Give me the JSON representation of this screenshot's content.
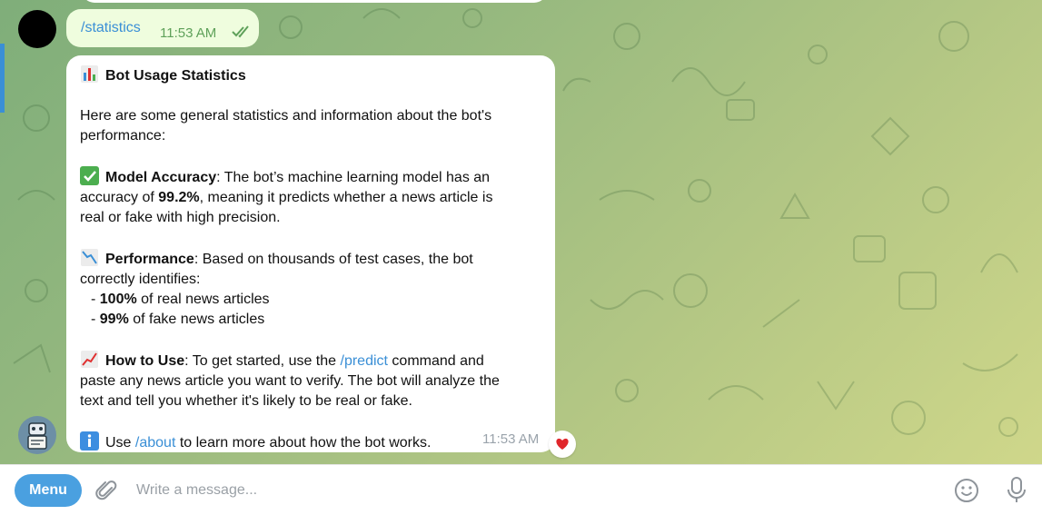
{
  "chat": {
    "command": {
      "text": "/statistics",
      "time": "11:53 AM"
    },
    "bot_message": {
      "title": "Bot Usage Statistics",
      "intro_1": "Here are some general statistics and information about the bot's",
      "intro_2": "performance:",
      "accuracy": {
        "label": "Model Accuracy",
        "text_1": ": The bot’s machine learning model has an",
        "text_2a": "accuracy of ",
        "value": "99.2%",
        "text_2b": ", meaning it predicts whether a news article is",
        "text_3": "real or fake with high precision."
      },
      "performance": {
        "label": "Performance",
        "text_1": ": Based on thousands of test cases, the bot",
        "text_2": "correctly identifies:",
        "item_1_prefix": "- ",
        "item_1_value": "100%",
        "item_1_text": " of real news articles",
        "item_2_prefix": "- ",
        "item_2_value": "99%",
        "item_2_text": " of fake news articles"
      },
      "how_to_use": {
        "label": "How to Use",
        "text_1a": ": To get started, use the ",
        "link": "/predict",
        "text_1b": " command and",
        "text_2": "paste any news article you want to verify. The bot will analyze the",
        "text_3": "text and tell you whether it's likely to be real or fake."
      },
      "about": {
        "text_a": "Use ",
        "link": "/about",
        "text_b": " to learn more about how the bot works."
      },
      "time": "11:53 AM",
      "reaction": "heart"
    }
  },
  "input_bar": {
    "menu_label": "Menu",
    "placeholder": "Write a message..."
  },
  "colors": {
    "accent": "#3a8fd6",
    "outgoing_bubble": "#effdde",
    "check_green": "#5fa15a",
    "menu_button": "#4aa0e0"
  },
  "icons": [
    "bar-chart-icon",
    "check-mark-icon",
    "chart-decreasing-icon",
    "chart-increasing-icon",
    "info-icon",
    "double-check-icon",
    "heart-icon",
    "paperclip-icon",
    "smiley-icon",
    "microphone-icon",
    "robot-icon"
  ]
}
